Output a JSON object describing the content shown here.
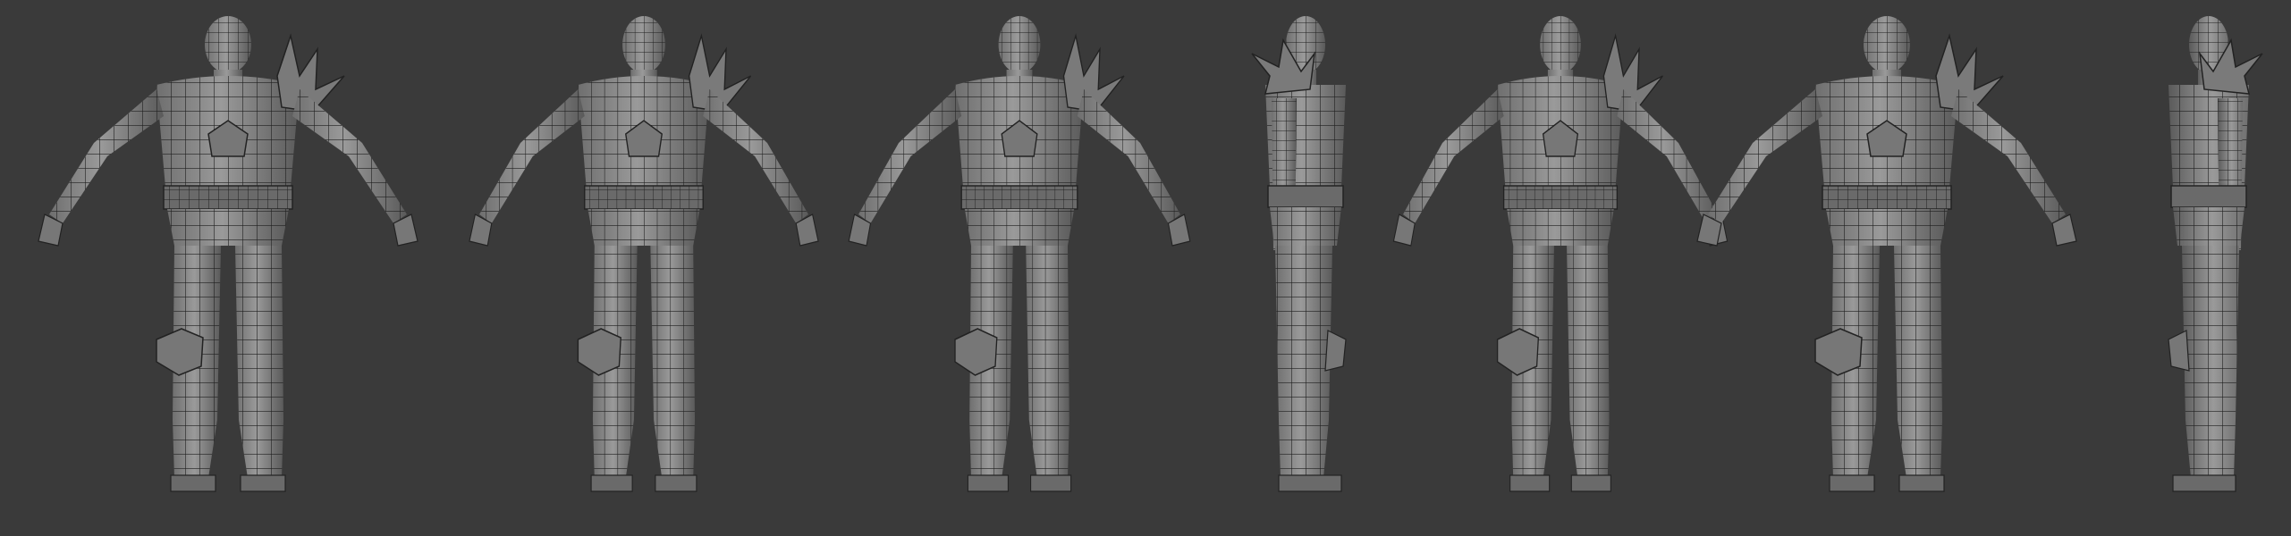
{
  "scene": {
    "description_hidden": false,
    "background_color": "#3a3a3a",
    "model_fill": "#8a8a8a",
    "model_shadow": "#5c5c5c",
    "wire_color": "#1e1e1e",
    "views": [
      {
        "name": "front"
      },
      {
        "name": "three-quarter-front-right"
      },
      {
        "name": "three-quarter-front-left"
      },
      {
        "name": "side-left"
      },
      {
        "name": "three-quarter-back-left"
      },
      {
        "name": "back"
      },
      {
        "name": "side-right"
      }
    ]
  }
}
